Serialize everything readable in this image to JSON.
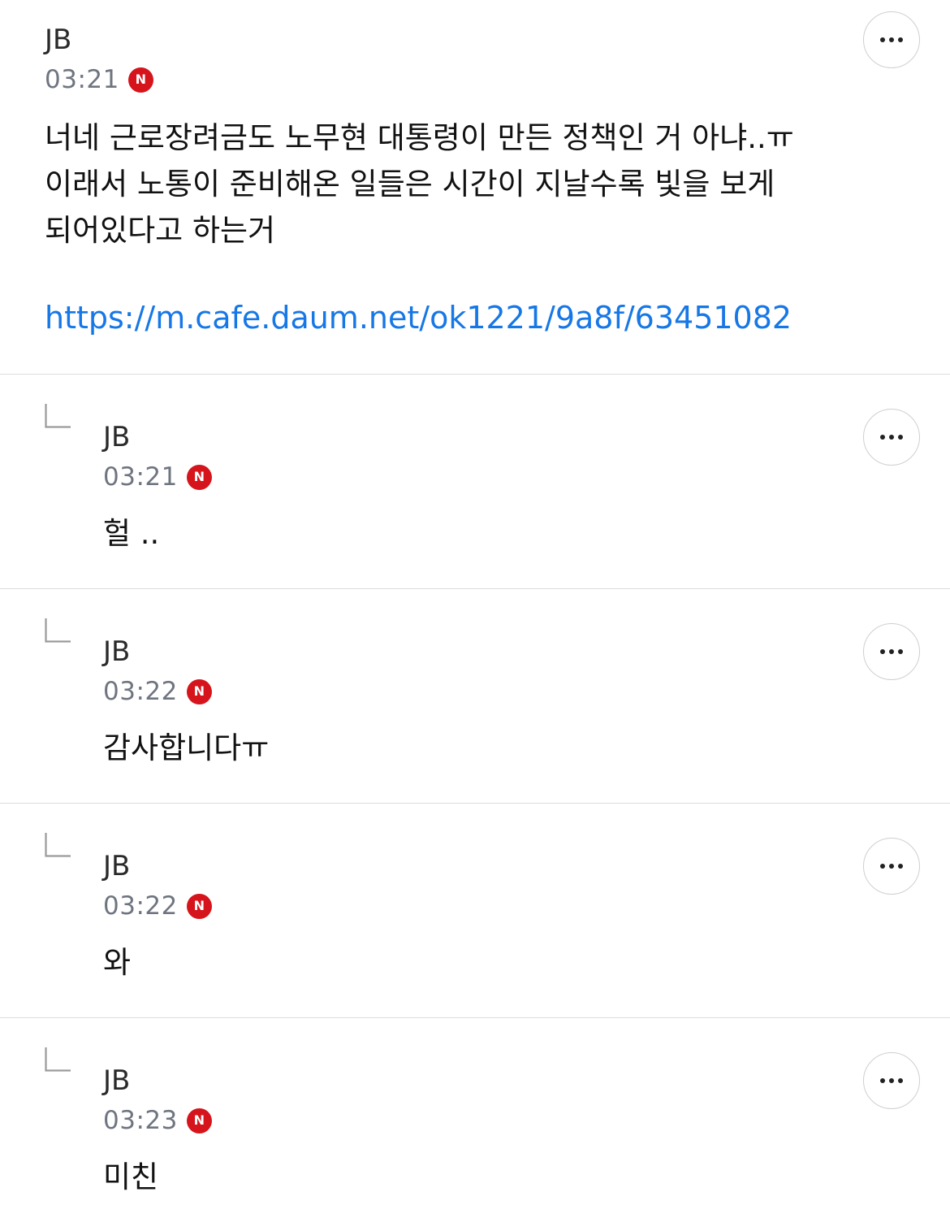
{
  "comments": [
    {
      "author": "JB",
      "time": "03:21",
      "badge": "N",
      "lines": [
        "너네 근로장려금도 노무현 대통령이 만든 정책인 거 아냐..ㅠ",
        "이래서 노통이 준비해온 일들은 시간이 지날수록 빛을 보게",
        "되어있다고 하는거"
      ],
      "link": "https://m.cafe.daum.net/ok1221/9a8f/63451082"
    }
  ],
  "replies": [
    {
      "author": "JB",
      "time": "03:21",
      "badge": "N",
      "text": "헐 .."
    },
    {
      "author": "JB",
      "time": "03:22",
      "badge": "N",
      "text": "감사합니다ㅠ"
    },
    {
      "author": "JB",
      "time": "03:22",
      "badge": "N",
      "text": "와"
    },
    {
      "author": "JB",
      "time": "03:23",
      "badge": "N",
      "text": "미친"
    }
  ],
  "icons": {
    "more": "more-horizontal-icon",
    "reply": "reply-arrow-icon"
  },
  "colors": {
    "badge": "#d5141b",
    "link": "#1677e6",
    "time": "#6f7580",
    "divider": "#dcdcdc"
  }
}
